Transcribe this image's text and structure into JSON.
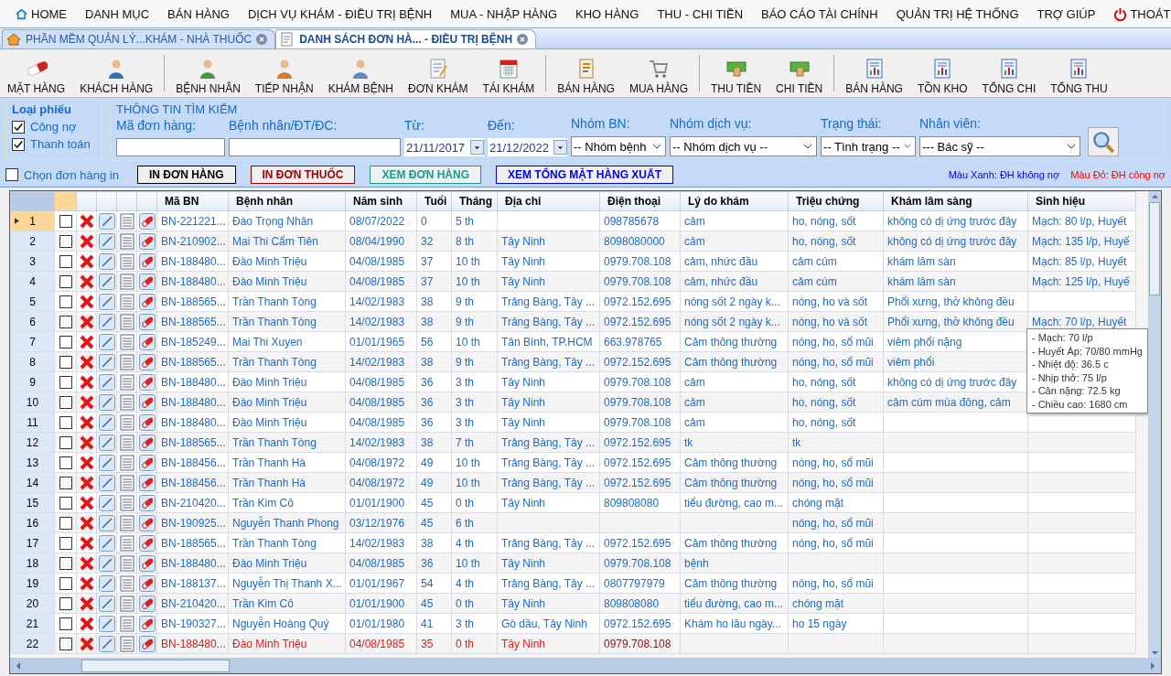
{
  "menu": [
    {
      "label": "HOME",
      "kind": "home"
    },
    {
      "label": "DANH MỤC",
      "kind": "plain"
    },
    {
      "label": "BÁN HÀNG",
      "kind": "plain"
    },
    {
      "label": "DỊCH VỤ KHÁM - ĐIỀU TRỊ BỆNH",
      "kind": "plain"
    },
    {
      "label": "MUA - NHẬP HÀNG",
      "kind": "plain"
    },
    {
      "label": "KHO HÀNG",
      "kind": "plain"
    },
    {
      "label": "THU - CHI TIỀN",
      "kind": "plain"
    },
    {
      "label": "BÁO CÁO TÀI CHÍNH",
      "kind": "plain"
    },
    {
      "label": "QUẢN TRỊ HỆ THỐNG",
      "kind": "plain"
    },
    {
      "label": "TRỢ GIÚP",
      "kind": "plain"
    },
    {
      "label": "THOÁT",
      "kind": "exit"
    }
  ],
  "tabs": [
    {
      "label": "PHẦN MỀM QUẢN LÝ...KHÁM - NHÀ THUỐC",
      "kind": "home",
      "selected": false
    },
    {
      "label": "DANH SÁCH ĐƠN HÀ... - ĐIỀU TRỊ BỆNH",
      "kind": "form",
      "selected": true
    }
  ],
  "toolbar": [
    [
      {
        "label": "MẶT HÀNG",
        "kind": "pill"
      },
      {
        "label": "KHÁCH HÀNG",
        "kind": "customer"
      }
    ],
    [
      {
        "label": "BỆNH NHÂN",
        "kind": "patient"
      },
      {
        "label": "TIẾP NHẬN",
        "kind": "reception"
      },
      {
        "label": "KHÁM BỆNH",
        "kind": "doctor"
      },
      {
        "label": "ĐƠN KHÁM",
        "kind": "form"
      },
      {
        "label": "TÁI KHÁM",
        "kind": "calendar"
      }
    ],
    [
      {
        "label": "BÁN HÀNG",
        "kind": "sales"
      },
      {
        "label": "MUA HÀNG",
        "kind": "cart"
      }
    ],
    [
      {
        "label": "THU TIỀN",
        "kind": "money"
      },
      {
        "label": "CHI TIỀN",
        "kind": "money"
      }
    ],
    [
      {
        "label": "BÁN HÀNG",
        "kind": "report"
      },
      {
        "label": "TỒN KHO",
        "kind": "report"
      },
      {
        "label": "TỔNG CHI",
        "kind": "report"
      },
      {
        "label": "TỔNG THU",
        "kind": "report"
      }
    ]
  ],
  "ticket_type": {
    "title": "Loại phiếu",
    "options": [
      {
        "label": "Công nợ",
        "checked": true
      },
      {
        "label": "Thanh toán",
        "checked": true
      }
    ]
  },
  "search": {
    "title": "THÔNG TIN TÌM KIẾM",
    "fields": [
      {
        "label": "Mã đơn hàng:",
        "kind": "text"
      },
      {
        "label": "Bệnh nhân/ĐT/ĐC:",
        "kind": "text"
      },
      {
        "label": "Từ:",
        "kind": "date",
        "value": "21/11/2017"
      },
      {
        "label": "Đến:",
        "kind": "date",
        "value": "21/12/2022"
      },
      {
        "label": "Nhóm BN:",
        "kind": "select",
        "value": "-- Nhóm bệnh"
      },
      {
        "label": "Nhóm dịch vụ:",
        "kind": "select",
        "value": "-- Nhóm dịch vụ --"
      },
      {
        "label": "Trạng thái:",
        "kind": "select",
        "value": "-- Tình trạng --"
      },
      {
        "label": "Nhân viên:",
        "kind": "select",
        "value": "--- Bác sỹ --"
      }
    ]
  },
  "print_select": {
    "label": "Chọn đơn hàng in",
    "checked": false
  },
  "actions": [
    {
      "label": "IN ĐƠN HÀNG",
      "color": "#000000"
    },
    {
      "label": "IN ĐƠN THUỐC",
      "color": "#a00000"
    },
    {
      "label": "XEM ĐƠN HÀNG",
      "color": "#1a9a8a"
    },
    {
      "label": "XEM TỔNG MẶT HÀNG XUẤT",
      "color": "#0000e0"
    }
  ],
  "legend": [
    {
      "label": "Màu Xanh: ĐH không nợ",
      "color": "#0000ff"
    },
    {
      "label": "Màu Đỏ:  ĐH công nợ",
      "color": "#ff0000"
    }
  ],
  "table": {
    "columns": [
      "Mã BN",
      "Bệnh nhân",
      "Năm sinh",
      "Tuổi",
      "Tháng",
      "Địa chỉ",
      "Điện thoại",
      "Lý do khám",
      "Triệu chứng",
      "Khám lâm sàng",
      "Sinh hiệu"
    ],
    "rows": [
      {
        "number": "1",
        "selected": true,
        "checked": false,
        "debt": false,
        "cells": [
          "BN-221221...",
          "Đào Trọng Nhân",
          "08/07/2022",
          "0",
          "5 th",
          null,
          "098785678",
          "cảm",
          "ho, nóng, sốt",
          "không có dị ứng trước đây",
          "Mạch: 80 l/p, Huyết"
        ]
      },
      {
        "number": "2",
        "selected": false,
        "checked": false,
        "debt": false,
        "cells": [
          "BN-210902...",
          "Mai Thi Cẩm Tiên",
          "08/04/1990",
          "32",
          "8 th",
          "Tây Ninh",
          "8098080000",
          "cảm",
          "ho, nóng, sốt",
          "không có dị ứng trước đây",
          "Mạch: 135 l/p, Huyế"
        ]
      },
      {
        "number": "3",
        "selected": false,
        "checked": false,
        "debt": false,
        "cells": [
          "BN-188480...",
          "Đào Minh Triệu",
          "04/08/1985",
          "37",
          "10 th",
          "Tây Ninh",
          "0979.708.108",
          "cảm, nhức đầu",
          "cảm cúm",
          "khám lâm sàn",
          "Mạch: 85 l/p, Huyết"
        ]
      },
      {
        "number": "4",
        "selected": false,
        "checked": false,
        "debt": false,
        "cells": [
          "BN-188480...",
          "Đào Minh Triệu",
          "04/08/1985",
          "37",
          "10 th",
          "Tây Ninh",
          "0979.708.108",
          "cảm, nhức đầu",
          "cảm cúm",
          "khám lâm sàn",
          "Mạch: 125 l/p, Huyế"
        ]
      },
      {
        "number": "5",
        "selected": false,
        "checked": false,
        "debt": false,
        "cells": [
          "BN-188565...",
          "Trần Thanh Tòng",
          "14/02/1983",
          "38",
          "9 th",
          "Trảng Bàng, Tây ...",
          "0972.152.695",
          "nóng sốt 2 ngày k...",
          "nóng, ho và sốt",
          "Phổi xưng, thở không đều",
          null
        ]
      },
      {
        "number": "6",
        "selected": false,
        "checked": false,
        "debt": false,
        "cells": [
          "BN-188565...",
          "Trần Thanh Tòng",
          "14/02/1983",
          "38",
          "9 th",
          "Trảng Bàng, Tây ...",
          "0972.152.695",
          "nóng sốt 2 ngày k...",
          "nóng, ho và sốt",
          "Phổi xưng, thở không đều",
          "Mạch: 70 l/p, Huyết"
        ]
      },
      {
        "number": "7",
        "selected": false,
        "checked": false,
        "debt": false,
        "cells": [
          "BN-185249...",
          "Mai Thi Xuyen",
          "01/01/1965",
          "56",
          "10 th",
          "Tân Bình, TP.HCM",
          "663.978765",
          "Cảm thông thường",
          "nóng, ho, sổ mũi",
          "viêm phổi nặng",
          null
        ]
      },
      {
        "number": "8",
        "selected": false,
        "checked": false,
        "debt": false,
        "cells": [
          "BN-188565...",
          "Trần Thanh Tòng",
          "14/02/1983",
          "38",
          "9 th",
          "Trảng Bàng, Tây ...",
          "0972.152.695",
          "Cảm thông thường",
          "nóng, ho, sổ mũi",
          "viêm phổi",
          null
        ]
      },
      {
        "number": "9",
        "selected": false,
        "checked": false,
        "debt": false,
        "cells": [
          "BN-188480...",
          "Đào Minh Triệu",
          "04/08/1985",
          "36",
          "3 th",
          "Tây Ninh",
          "0979.708.108",
          "cảm",
          "ho, nóng, sốt",
          "không có dị ứng trước đây",
          null
        ]
      },
      {
        "number": "10",
        "selected": false,
        "checked": false,
        "debt": false,
        "cells": [
          "BN-188480...",
          "Đào Minh Triệu",
          "04/08/1985",
          "36",
          "3 th",
          "Tây Ninh",
          "0979.708.108",
          "cảm",
          "ho, nóng, sốt",
          "cảm cúm mùa đông, cảm",
          null
        ]
      },
      {
        "number": "11",
        "selected": false,
        "checked": false,
        "debt": false,
        "cells": [
          "BN-188480...",
          "Đào Minh Triệu",
          "04/08/1985",
          "36",
          "3 th",
          "Tây Ninh",
          "0979.708.108",
          "cảm",
          "ho, nóng, sốt",
          null,
          null
        ]
      },
      {
        "number": "12",
        "selected": false,
        "checked": false,
        "debt": false,
        "cells": [
          "BN-188565...",
          "Trần Thanh Tòng",
          "14/02/1983",
          "38",
          "7 th",
          "Trảng Bàng, Tây ...",
          "0972.152.695",
          "tk",
          "tk",
          null,
          null
        ]
      },
      {
        "number": "13",
        "selected": false,
        "checked": false,
        "debt": false,
        "cells": [
          "BN-188456...",
          "Trần Thanh Hà",
          "04/08/1972",
          "49",
          "10 th",
          "Trảng Bàng, Tây ...",
          "0972.152.695",
          "Cảm thông thường",
          "nóng, ho, sổ mũi",
          null,
          null
        ]
      },
      {
        "number": "14",
        "selected": false,
        "checked": false,
        "debt": false,
        "cells": [
          "BN-188456...",
          "Trần Thanh Hà",
          "04/08/1972",
          "49",
          "10 th",
          "Trảng Bàng, Tây ...",
          "0972.152.695",
          "Cảm thông thường",
          "nóng, ho, sổ mũi",
          null,
          null
        ]
      },
      {
        "number": "15",
        "selected": false,
        "checked": false,
        "debt": false,
        "cells": [
          "BN-210420...",
          "Trần Kim Cô",
          "01/01/1900",
          "45",
          "0 th",
          "Tây Ninh",
          "809808080",
          "tiểu đường, cao m...",
          "chóng mặt",
          null,
          null
        ]
      },
      {
        "number": "16",
        "selected": false,
        "checked": false,
        "debt": false,
        "cells": [
          "BN-190925...",
          "Nguyễn Thanh Phong",
          "03/12/1976",
          "45",
          "6 th",
          null,
          null,
          null,
          "nóng, ho, sổ mũi",
          null,
          null
        ]
      },
      {
        "number": "17",
        "selected": false,
        "checked": false,
        "debt": false,
        "cells": [
          "BN-188565...",
          "Trần Thanh Tòng",
          "14/02/1983",
          "38",
          "4 th",
          "Trảng Bàng, Tây ...",
          "0972.152.695",
          "Cảm thông thường",
          "nóng, ho, sổ mũi",
          null,
          null
        ]
      },
      {
        "number": "18",
        "selected": false,
        "checked": false,
        "debt": false,
        "cells": [
          "BN-188480...",
          "Đào Minh Triệu",
          "04/08/1985",
          "36",
          "10 th",
          "Tây Ninh",
          "0979.708.108",
          "bệnh",
          null,
          null,
          null
        ]
      },
      {
        "number": "19",
        "selected": false,
        "checked": false,
        "debt": false,
        "cells": [
          "BN-188137...",
          "Nguyễn Thị Thanh X...",
          "01/01/1967",
          "54",
          "4 th",
          "Trảng Bàng, Tây ...",
          "0807797979",
          "Cảm thông thường",
          "nóng, ho, sổ mũi",
          null,
          null
        ]
      },
      {
        "number": "20",
        "selected": false,
        "checked": false,
        "debt": false,
        "cells": [
          "BN-210420...",
          "Trần Kim Cô",
          "01/01/1900",
          "45",
          "0 th",
          "Tây Ninh",
          "809808080",
          "tiểu đường, cao m...",
          "chóng mặt",
          null,
          null
        ]
      },
      {
        "number": "21",
        "selected": false,
        "checked": false,
        "debt": false,
        "cells": [
          "BN-190327...",
          "Nguyễn Hoàng Quý",
          "01/01/1980",
          "41",
          "3 th",
          "Gò dầu, Tây Ninh",
          "0972.152.695",
          "Khám ho lâu ngày...",
          "ho 15 ngày",
          null,
          null
        ]
      },
      {
        "number": "22",
        "selected": false,
        "checked": false,
        "debt": true,
        "cells": [
          "BN-188480...",
          "Đào Minh Triệu",
          "04/08/1985",
          "35",
          "0 th",
          "Tây Ninh",
          "0979.708.108",
          null,
          null,
          null,
          null
        ]
      }
    ]
  },
  "tooltip": [
    "- Mạch: 70 l/p",
    "- Huyết Áp: 70/80 mmHg",
    "- Nhiệt độ: 36.5 c",
    "- Nhịp thở: 75 l/p",
    "- Cân nặng: 72.5 kg",
    "- Chiều cao: 1680 cm"
  ]
}
